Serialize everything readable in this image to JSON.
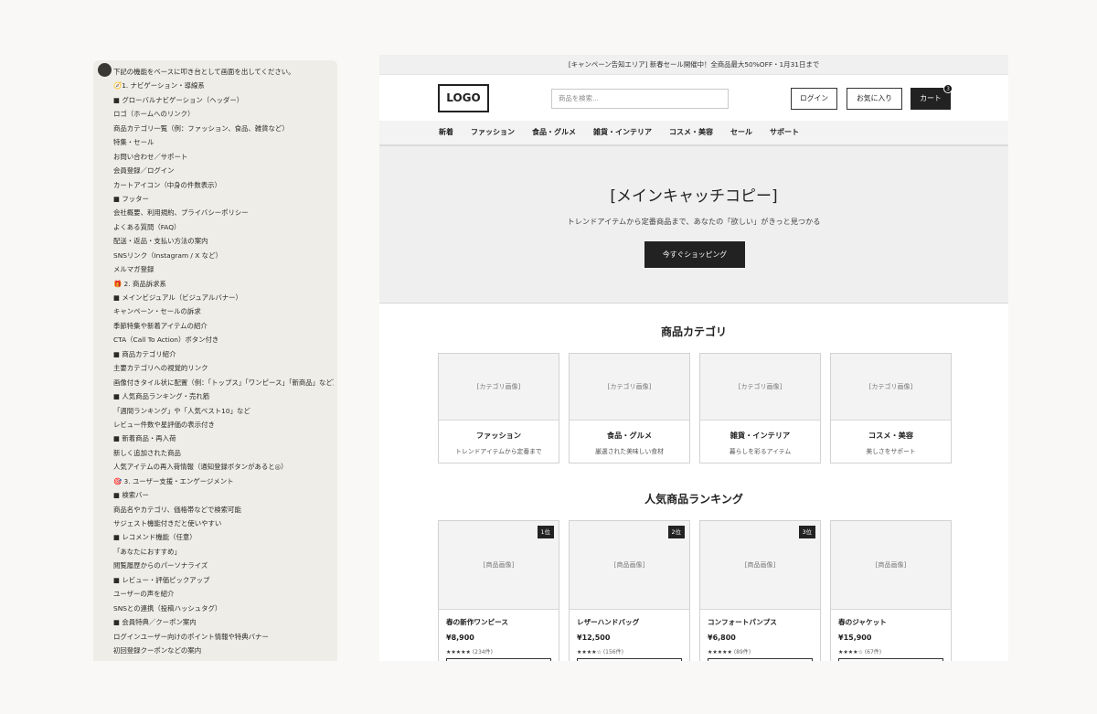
{
  "chat": {
    "lines": [
      "下記の機能をベースに叩き台として画面を出してください。",
      "🧭1. ナビゲーション・導線系",
      "■ グローバルナビゲーション（ヘッダー）",
      "ロゴ（ホームへのリンク）",
      "商品カテゴリ一覧（例：ファッション、食品、雑貨など）",
      "特集・セール",
      "お問い合わせ／サポート",
      "会員登録／ログイン",
      "カートアイコン（中身の件数表示）",
      "■ フッター",
      "会社概要、利用規約、プライバシーポリシー",
      "よくある質問（FAQ）",
      "配送・返品・支払い方法の案内",
      "SNSリンク（Instagram / X など）",
      "メルマガ登録",
      "🎁 2. 商品訴求系",
      "■ メインビジュアル（ビジュアルバナー）",
      "キャンペーン・セールの訴求",
      "季節特集や新着アイテムの紹介",
      "CTA（Call To Action）ボタン付き",
      "■ 商品カテゴリ紹介",
      "主要カテゴリへの視覚的リンク",
      "画像付きタイル状に配置（例：「トップス」「ワンピース」「新商品」など）",
      "■ 人気商品ランキング・売れ筋",
      "「週間ランキング」や「人気ベスト10」など",
      "レビュー件数や星評価の表示付き",
      "■ 新着商品・再入荷",
      "新しく追加された商品",
      "人気アイテムの再入荷情報（通知登録ボタンがあると◎）",
      "🎯 3. ユーザー支援・エンゲージメント",
      "■ 検索バー",
      "商品名やカテゴリ、価格帯などで検索可能",
      "サジェスト機能付きだと使いやすい",
      "■ レコメンド機能（任意）",
      "「あなたにおすすめ」",
      "閲覧履歴からのパーソナライズ",
      "■ レビュー・評価ピックアップ",
      "ユーザーの声を紹介",
      "SNSとの連携（投稿ハッシュタグ）",
      "■ 会員特典／クーポン案内",
      "ログインユーザー向けのポイント情報や特典バナー",
      "初回登録クーポンなどの案内"
    ]
  },
  "preview": {
    "banner": "[キャンペーン告知エリア] 新春セール開催中！全商品最大50%OFF・1月31日まで",
    "logo": "LOGO",
    "search_placeholder": "商品を検索...",
    "login": "ログイン",
    "favorites": "お気に入り",
    "cart": "カート",
    "cart_count": "3",
    "nav": [
      "新着",
      "ファッション",
      "食品・グルメ",
      "雑貨・インテリア",
      "コスメ・美容",
      "セール",
      "サポート"
    ],
    "hero": {
      "title": "[メインキャッチコピー]",
      "subtitle": "トレンドアイテムから定番商品まで、あなたの「欲しい」がきっと見つかる",
      "cta": "今すぐショッピング"
    },
    "categories_title": "商品カテゴリ",
    "categories": [
      {
        "image": "[カテゴリ画像]",
        "name": "ファッション",
        "desc": "トレンドアイテムから定番まで"
      },
      {
        "image": "[カテゴリ画像]",
        "name": "食品・グルメ",
        "desc": "厳選された美味しい食材"
      },
      {
        "image": "[カテゴリ画像]",
        "name": "雑貨・インテリア",
        "desc": "暮らしを彩るアイテム"
      },
      {
        "image": "[カテゴリ画像]",
        "name": "コスメ・美容",
        "desc": "美しさをサポート"
      }
    ],
    "ranking_title": "人気商品ランキング",
    "ranking": [
      {
        "badge": "1位",
        "image": "[商品画像]",
        "name": "春の新作ワンピース",
        "price": "¥8,900",
        "stars": "★★★★★",
        "count": "(234件)"
      },
      {
        "badge": "2位",
        "image": "[商品画像]",
        "name": "レザーハンドバッグ",
        "price": "¥12,500",
        "stars": "★★★★☆",
        "count": "(156件)"
      },
      {
        "badge": "3位",
        "image": "[商品画像]",
        "name": "コンフォートパンプス",
        "price": "¥6,800",
        "stars": "★★★★★",
        "count": "(89件)"
      },
      {
        "badge": "",
        "image": "[商品画像]",
        "name": "春のジャケット",
        "price": "¥15,900",
        "stars": "★★★★☆",
        "count": "(67件)"
      }
    ]
  }
}
